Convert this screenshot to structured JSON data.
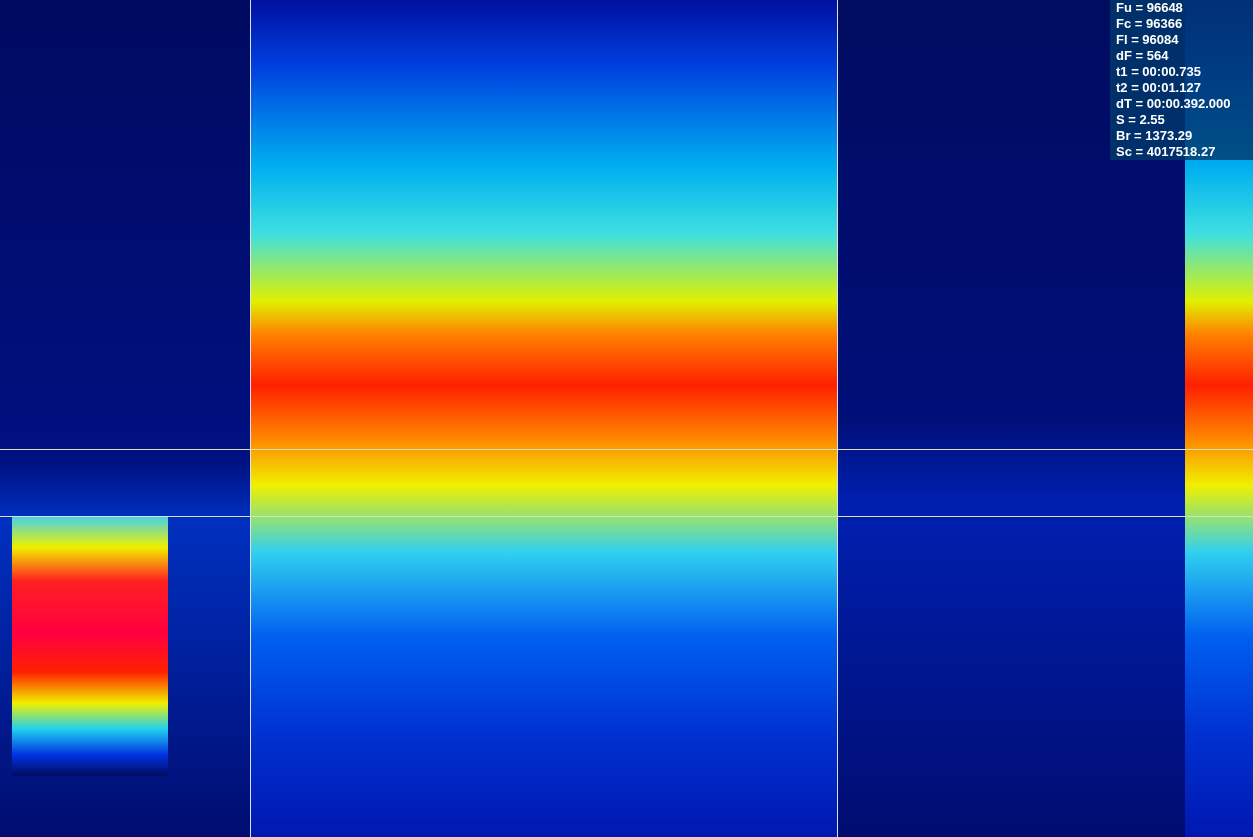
{
  "readout": {
    "lines": [
      "Fu = 96648",
      "Fc = 96366",
      "Fl = 96084",
      "dF = 564",
      "t1 = 00:00.735",
      "t2 = 00:01.127",
      "dT = 00:00.392.000",
      "S = 2.55",
      "Br = 1373.29",
      "Sc = 4017518.27"
    ]
  }
}
